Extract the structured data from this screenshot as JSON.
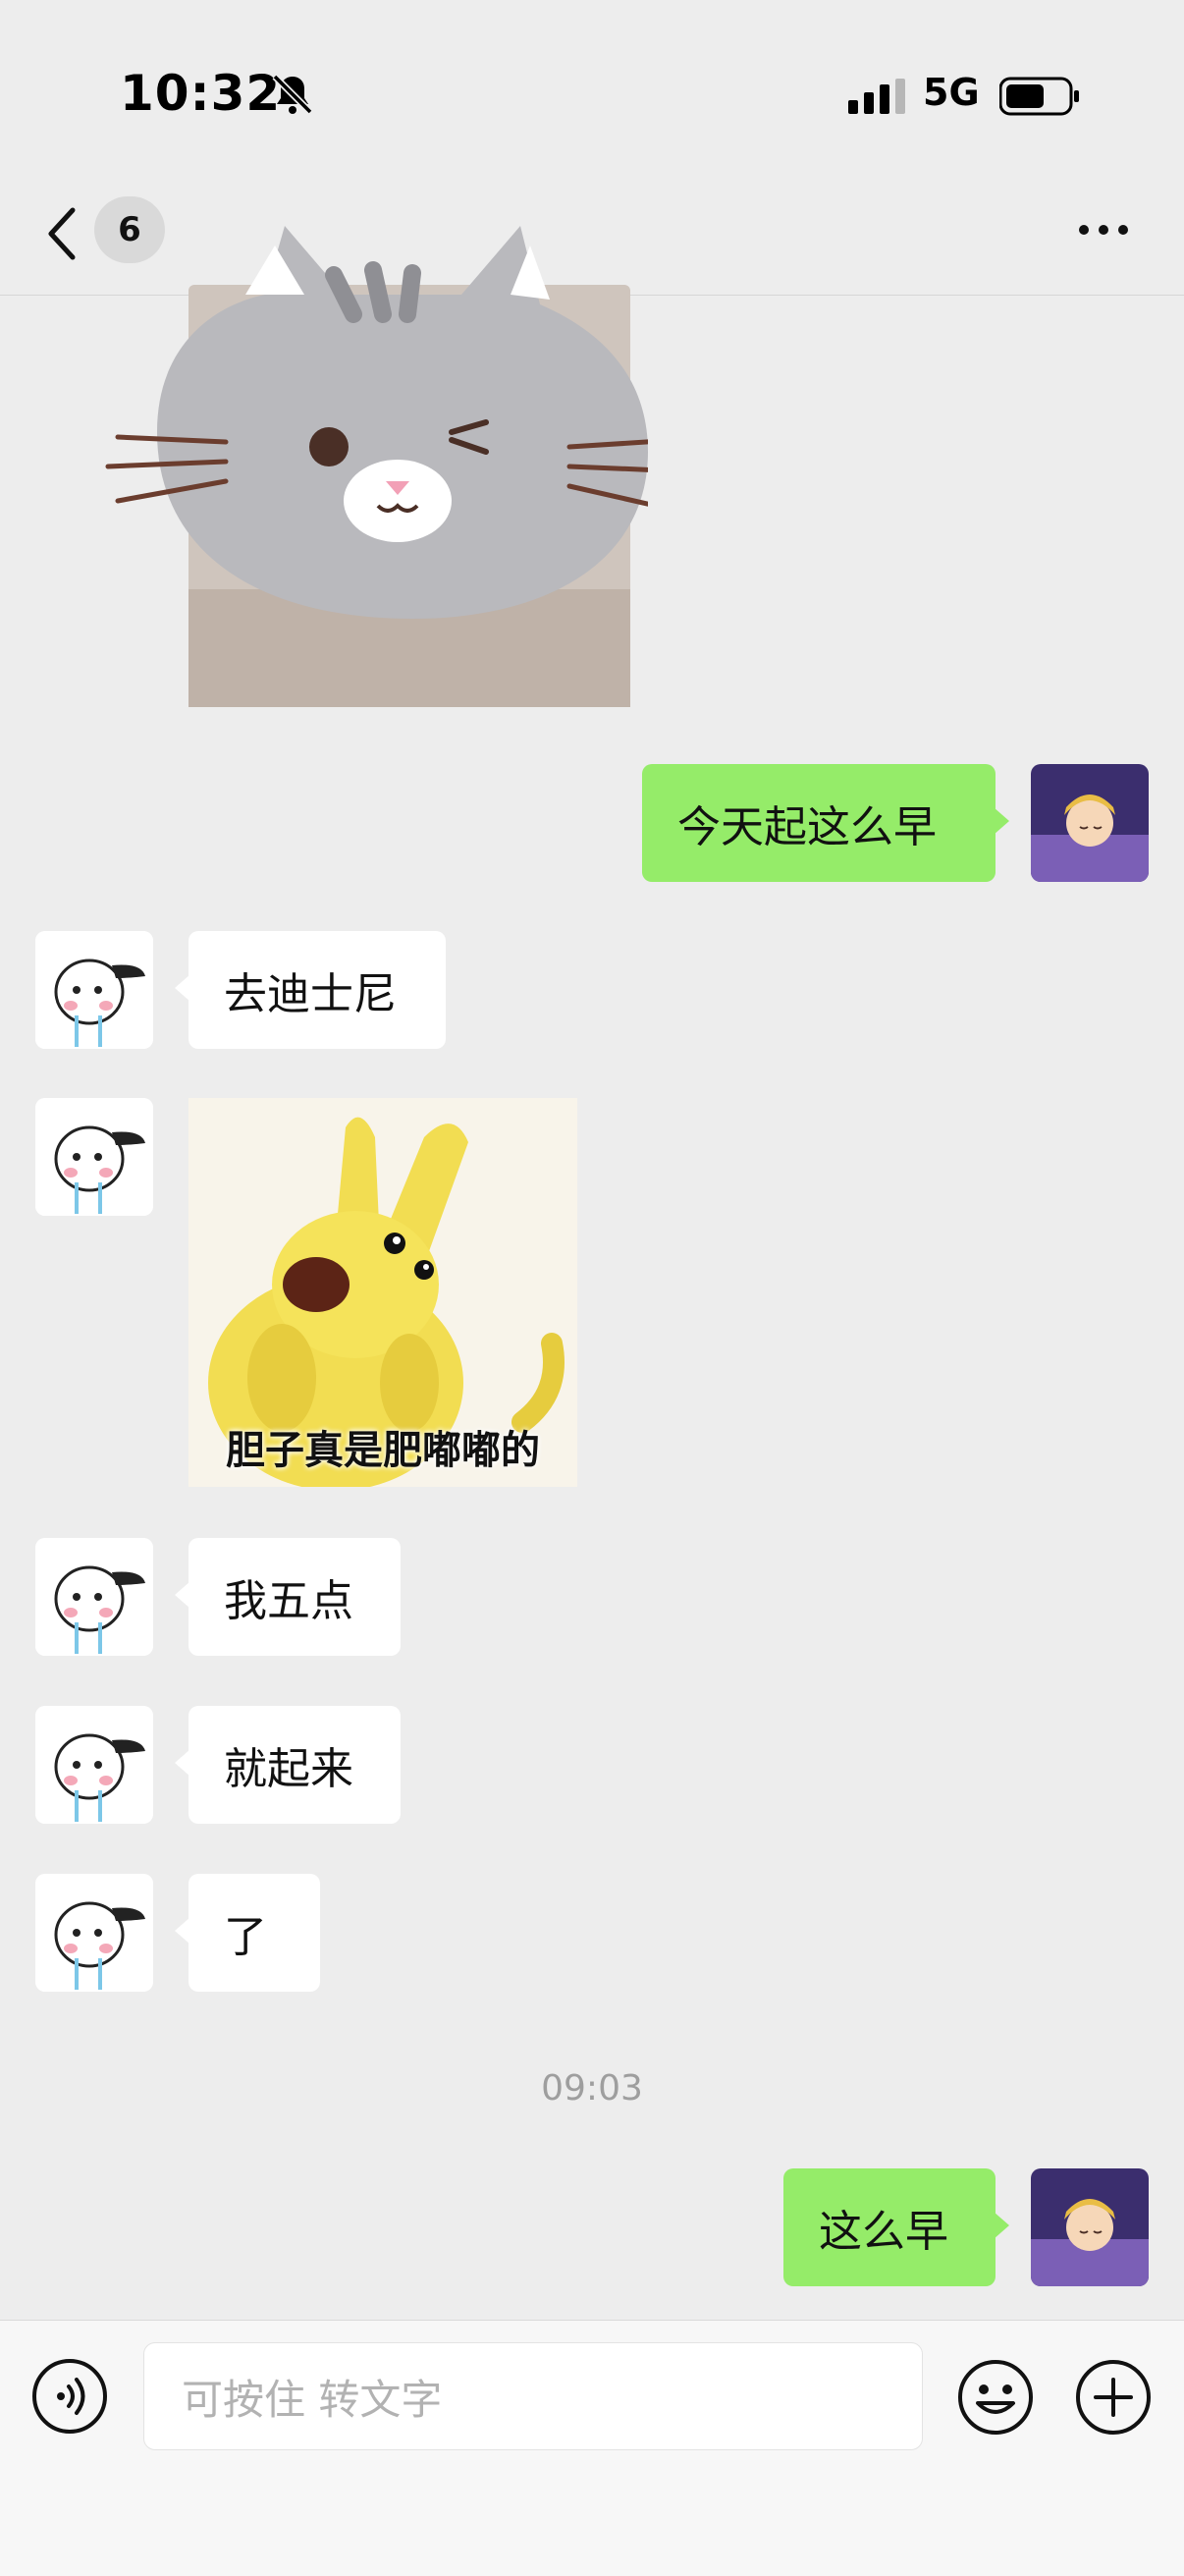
{
  "status_bar": {
    "time": "10:32",
    "network": "5G"
  },
  "nav": {
    "unread_count": "6"
  },
  "messages": [
    {
      "type": "image",
      "side": "in",
      "content": "cat sticker"
    },
    {
      "type": "text",
      "side": "out",
      "text": "今天起这么早"
    },
    {
      "type": "text",
      "side": "in",
      "text": "去迪士尼"
    },
    {
      "type": "image",
      "side": "in",
      "caption": "胆子真是肥嘟嘟的"
    },
    {
      "type": "text",
      "side": "in",
      "text": "我五点"
    },
    {
      "type": "text",
      "side": "in",
      "text": "就起来"
    },
    {
      "type": "text",
      "side": "in",
      "text": "了"
    },
    {
      "type": "timestamp",
      "text": "09:03"
    },
    {
      "type": "text",
      "side": "out",
      "text": "这么早"
    }
  ],
  "input": {
    "placeholder": "可按住 转文字"
  },
  "colors": {
    "outgoing_bubble": "#95ec69",
    "incoming_bubble": "#ffffff",
    "background": "#ededed"
  },
  "icons": {
    "voice": "voice-icon",
    "emoji": "emoji-icon",
    "plus": "plus-icon",
    "back": "chevron-left-icon",
    "more": "more-icon"
  }
}
